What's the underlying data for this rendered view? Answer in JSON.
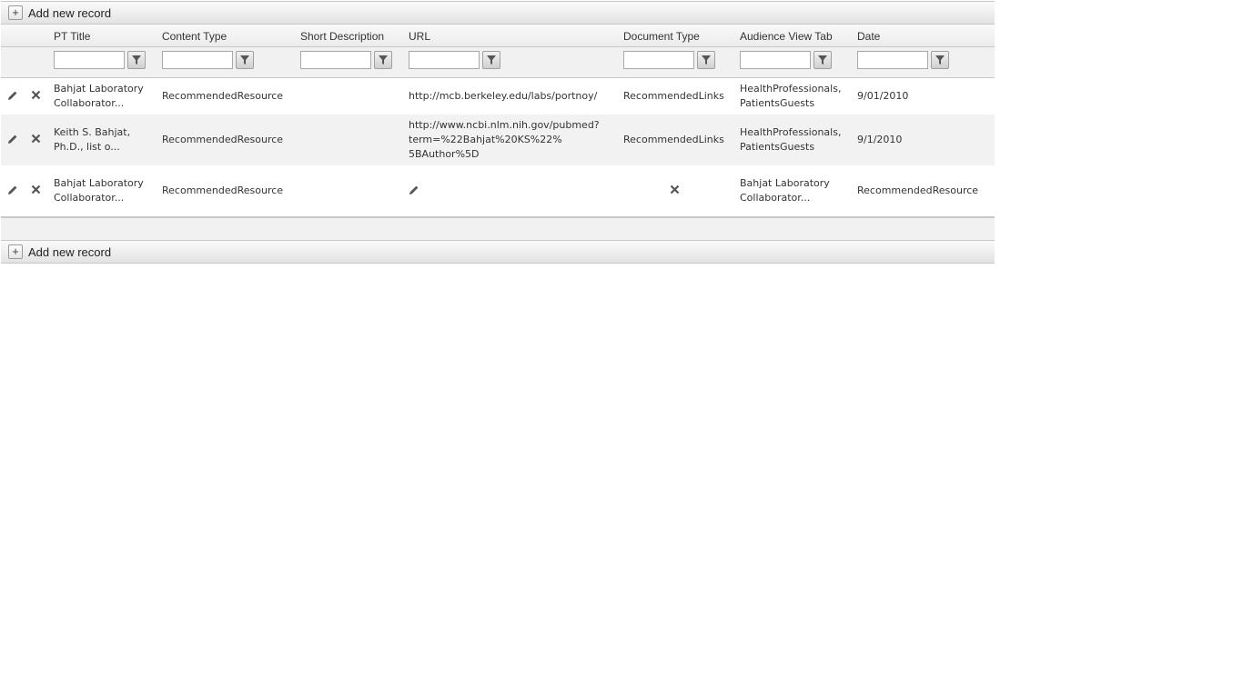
{
  "commands": {
    "add_label": "Add new record",
    "add_icon": "plus-icon"
  },
  "columns": [
    "PT Title",
    "Content Type",
    "Short Description",
    "URL",
    "Document Type",
    "Audience View Tab",
    "Date"
  ],
  "filters": [
    "",
    "",
    "",
    "",
    "",
    "",
    ""
  ],
  "rows": [
    {
      "title": [
        "Bahjat Laboratory",
        "Collaborator..."
      ],
      "content_type": "RecommendedResource",
      "short_description": "",
      "url": [
        "http://mcb.berkeley.edu/labs/portnoy/"
      ],
      "document_type": "RecommendedLinks",
      "audience": [
        "HealthProfessionals,",
        "PatientsGuests"
      ],
      "date": "9/01/2010"
    },
    {
      "title": [
        "Keith S. Bahjat,",
        "Ph.D., list o..."
      ],
      "content_type": "RecommendedResource",
      "short_description": "",
      "url": [
        "http://www.ncbi.nlm.nih.gov/pubmed?",
        "term=%22Bahjat%20KS%22%",
        "5BAuthor%5D"
      ],
      "document_type": "RecommendedLinks",
      "audience": [
        "HealthProfessionals,",
        "PatientsGuests"
      ],
      "date": "9/1/2010"
    },
    {
      "title": [
        "Bahjat Laboratory",
        "Collaborator..."
      ],
      "content_type": "RecommendedResource",
      "audience": [
        "Bahjat Laboratory",
        "Collaborator..."
      ],
      "date": "RecommendedResource"
    }
  ]
}
